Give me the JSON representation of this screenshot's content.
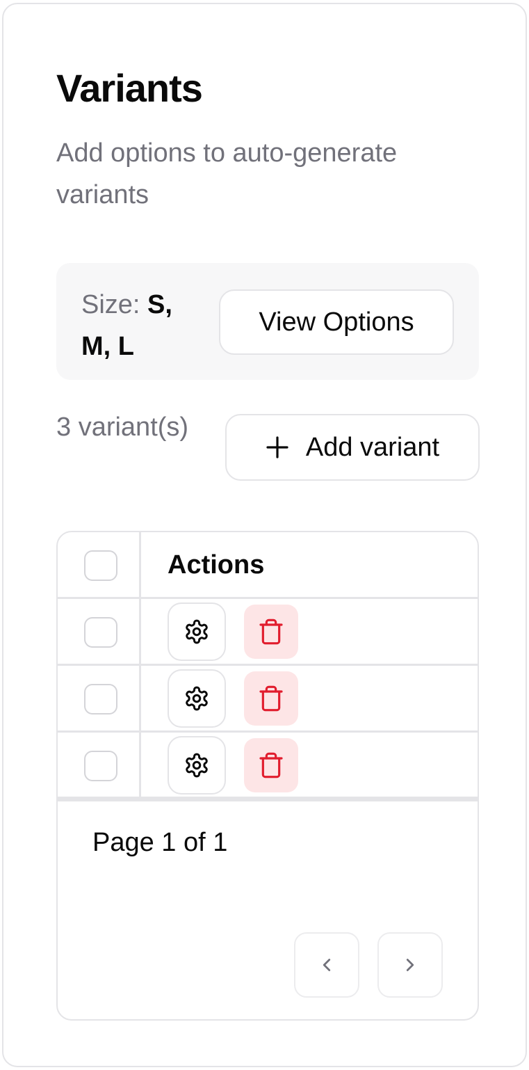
{
  "header": {
    "title": "Variants",
    "subtitle": "Add options to auto-generate variants"
  },
  "options": {
    "label": "Size:",
    "values": "S, M, L",
    "view_button": "View Options"
  },
  "summary": {
    "count_text": "3 variant(s)",
    "add_button": "Add variant",
    "add_icon": "plus-icon"
  },
  "table": {
    "columns": [
      "Actions"
    ],
    "rows": [
      {
        "actions": [
          "settings",
          "delete"
        ]
      },
      {
        "actions": [
          "settings",
          "delete"
        ]
      },
      {
        "actions": [
          "settings",
          "delete"
        ]
      }
    ],
    "icons": {
      "settings": "gear-icon",
      "delete": "trash-icon"
    },
    "footer": {
      "page_text": "Page 1 of 1",
      "prev_icon": "chevron-left-icon",
      "next_icon": "chevron-right-icon"
    }
  },
  "colors": {
    "text": "#0a0a0a",
    "muted": "#71717a",
    "border": "#e4e4e7",
    "panel": "#f7f7f8",
    "danger": "#e11d2e",
    "danger_bg": "#fde5e6"
  }
}
